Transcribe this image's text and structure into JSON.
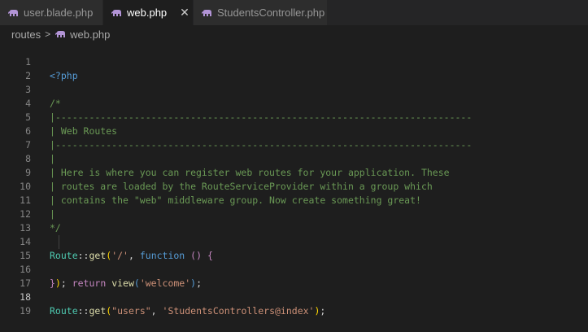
{
  "tabs": [
    {
      "label": "user.blade.php",
      "active": false,
      "icon": "php-elephant-icon"
    },
    {
      "label": "web.php",
      "active": true,
      "icon": "php-elephant-icon",
      "close": "✕"
    },
    {
      "label": "StudentsController.php",
      "active": false,
      "icon": "php-elephant-icon"
    }
  ],
  "breadcrumb": {
    "folder": "routes",
    "separator": ">",
    "file": "web.php"
  },
  "editor": {
    "current_line": 18,
    "line_numbers": [
      "1",
      "2",
      "3",
      "4",
      "5",
      "6",
      "7",
      "8",
      "9",
      "10",
      "11",
      "12",
      "13",
      "14",
      "15",
      "16",
      "17",
      "18",
      "19"
    ],
    "lines": {
      "l1": {
        "open_tag": "<?php"
      },
      "l3": {
        "text": "/*"
      },
      "l4": {
        "text": "|--------------------------------------------------------------------------"
      },
      "l5": {
        "text": "| Web Routes"
      },
      "l6": {
        "text": "|--------------------------------------------------------------------------"
      },
      "l7": {
        "text": "|"
      },
      "l8": {
        "text": "| Here is where you can register web routes for your application. These"
      },
      "l9": {
        "text": "| routes are loaded by the RouteServiceProvider within a group which"
      },
      "l10": {
        "text": "| contains the \"web\" middleware group. Now create something great!"
      },
      "l11": {
        "text": "|"
      },
      "l12": {
        "text": "*/"
      },
      "l14": {
        "class": "Route",
        "op": "::",
        "method": "get",
        "p1": "(",
        "str": "'/'",
        "comma": ", ",
        "kw": "function",
        "sp": " ",
        "parens": "()",
        "sp2": " ",
        "brace": "{"
      },
      "l15": {
        "indent": "    ",
        "kw": "return",
        "sp": " ",
        "func": "view",
        "p1": "(",
        "str": "'welcome'",
        "p2": ")",
        "semi": ";"
      },
      "l16": {
        "brace": "}",
        "p2": ")",
        "semi": ";"
      },
      "l18": {
        "class": "Route",
        "op": "::",
        "method": "get",
        "p1": "(",
        "str1": "\"users\"",
        "comma": ", ",
        "str2": "'StudentsControllers@index'",
        "p2": ")",
        "semi": ";"
      }
    }
  },
  "colors": {
    "background": "#1e1e1e",
    "tab_bar": "#252526",
    "comment": "#6a9955",
    "keyword": "#569cd6",
    "class": "#4ec9b0",
    "function": "#dcdcaa",
    "string": "#ce9178",
    "icon": "#b294d6"
  }
}
